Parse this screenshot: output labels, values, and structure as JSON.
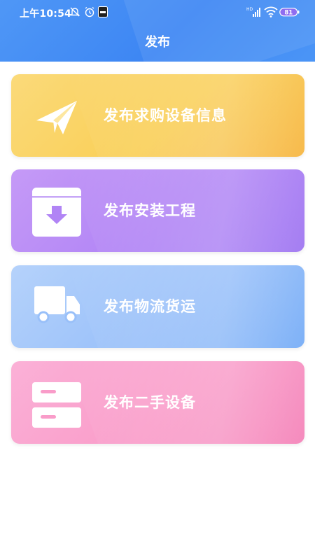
{
  "status_bar": {
    "time": "上午10:54",
    "battery": "81",
    "network": "HD"
  },
  "header": {
    "title": "发布"
  },
  "cards": [
    {
      "label": "发布求购设备信息",
      "icon": "paper-plane-icon",
      "color": "#f9cf57"
    },
    {
      "label": "发布安装工程",
      "icon": "download-box-icon",
      "color": "#b184f5"
    },
    {
      "label": "发布物流货运",
      "icon": "truck-icon",
      "color": "#99c0f9"
    },
    {
      "label": "发布二手设备",
      "icon": "drawer-icon",
      "color": "#f99cc9"
    }
  ]
}
